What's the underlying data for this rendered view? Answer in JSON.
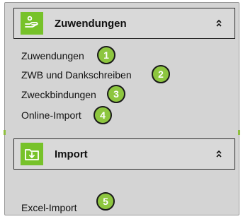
{
  "sections": [
    {
      "title": "Zuwendungen",
      "icon": "donation-hand-icon",
      "items": [
        {
          "label": "Zuwendungen",
          "badge": "1"
        },
        {
          "label": "ZWB und Dankschreiben",
          "badge": "2"
        },
        {
          "label": "Zweckbindungen",
          "badge": "3"
        },
        {
          "label": "Online-Import",
          "badge": "4"
        }
      ]
    },
    {
      "title": "Import",
      "icon": "import-folder-icon",
      "items": [
        {
          "label": "Excel-Import",
          "badge": "5"
        }
      ]
    }
  ],
  "colors": {
    "accent": "#77c22a",
    "badge": "#8dc63f",
    "panel": "#d4d4d4"
  }
}
